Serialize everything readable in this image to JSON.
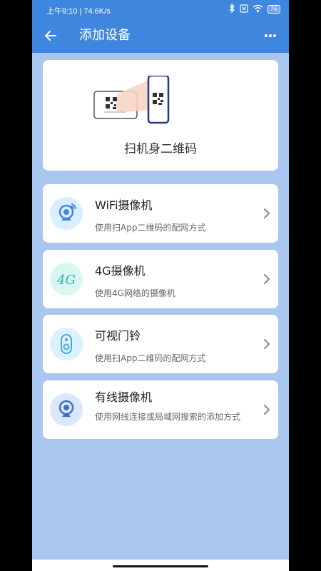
{
  "status_bar": {
    "left_text": "上午9:10 | 74.6K/s",
    "battery": "76",
    "icons": [
      "bluetooth-icon",
      "sim-icon",
      "wifi-icon",
      "battery-icon"
    ]
  },
  "app_bar": {
    "title": "添加设备",
    "back_icon": "arrow-left-icon",
    "more_icon": "more-dots-icon"
  },
  "scan_card": {
    "label": "扫机身二维码",
    "icon": "qr-scan-illustration"
  },
  "items": [
    {
      "title": "WiFi摄像机",
      "subtitle": "使用扫App二维码的配网方式",
      "icon": "wifi-camera-icon"
    },
    {
      "title": "4G摄像机",
      "subtitle": "使用4G网络的摄像机",
      "icon": "4g-camera-icon"
    },
    {
      "title": "可视门铃",
      "subtitle": "使用扫App二维码的配网方式",
      "icon": "doorbell-icon"
    },
    {
      "title": "有线摄像机",
      "subtitle": "使用网线连接或局域网搜索的添加方式",
      "icon": "wired-camera-icon"
    }
  ],
  "colors": {
    "primary": "#3f86de",
    "background": "#a9c7ee",
    "card": "#ffffff",
    "icon_bg": "#dbeeff"
  }
}
